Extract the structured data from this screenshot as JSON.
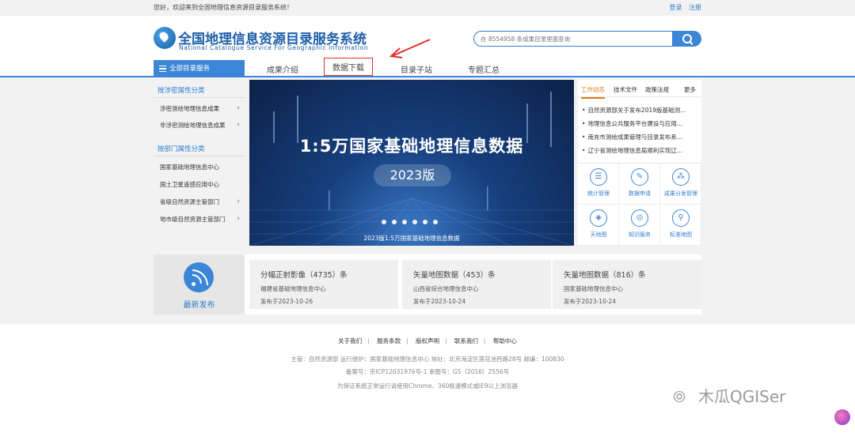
{
  "topbar": {
    "welcome": "您好，欢迎来到全国地理信息资源目录服务系统！",
    "login": "登录",
    "register": "注册"
  },
  "header": {
    "title": "全国地理信息资源目录服务系统",
    "subtitle": "National Catalogue Service For Geographic Information",
    "search_placeholder": "在 8554958 条成果目录里面查询"
  },
  "nav": {
    "all_label": "全部目录服务",
    "items": [
      "成果介绍",
      "数据下载",
      "目录子站",
      "专题汇总"
    ],
    "active": "数据下载"
  },
  "sidebar": {
    "group1": "按涉密属性分类",
    "group1_items": [
      "涉密测绘地理信息成果",
      "非涉密测绘地理信息成果"
    ],
    "group2": "按部门属性分类",
    "group2_items": [
      "国家基础地理信息中心",
      "国土卫星遥感应用中心",
      "省级自然资源主管部门",
      "地市级自然资源主管部门"
    ]
  },
  "banner": {
    "title": "1:5万国家基础地理信息数据",
    "version": "2023版",
    "caption": "2023版1:5万国家基础地理信息数据",
    "dot_count": 6
  },
  "right_panel": {
    "tabs": [
      "工作动态",
      "技术文件",
      "政策法规",
      "更多"
    ],
    "news": [
      "自然资源部关于发布2019版基础测...",
      "地理信息公共服务平台建设与应用...",
      "南充市测绘成果管理与目录发布系...",
      "辽宁省测绘地理信息局顺利实现辽..."
    ],
    "services": [
      {
        "label": "统计管理",
        "icon": "list-icon"
      },
      {
        "label": "数据申请",
        "icon": "edit-icon"
      },
      {
        "label": "成果分发管理",
        "icon": "share-icon"
      },
      {
        "label": "天地图",
        "icon": "map-icon"
      },
      {
        "label": "知识服务",
        "icon": "globe-icon"
      },
      {
        "label": "标准地图",
        "icon": "pin-icon"
      }
    ]
  },
  "latest": {
    "label": "最新发布",
    "cards": [
      {
        "title": "分幅正射影像（4735）条",
        "source": "福建省基础地理信息中心",
        "date": "发布于2023-10-26"
      },
      {
        "title": "矢量地图数据（453）条",
        "source": "山西省综合地理信息中心",
        "date": "发布于2023-10-24"
      },
      {
        "title": "矢量地图数据（816）条",
        "source": "国家基础地理信息中心",
        "date": "发布于2023-10-24"
      }
    ]
  },
  "footer": {
    "links": [
      "关于我们",
      "服务条款",
      "版权声明",
      "联系我们",
      "帮助中心"
    ],
    "line1": "主管：自然资源部  运行维护：国家基础地理信息中心  地址：北京海淀区莲花池西路28号  邮编：100830",
    "line2": "备案号：京ICP12031976号-1  审图号：GS（2016）2556号",
    "line3": "为保证系统正常运行请使用Chrome、360极速模式或IE9以上浏览器"
  },
  "watermark": "木瓜QGISer",
  "colors": {
    "brand_blue": "#3b86d6",
    "accent_orange": "#e07c1a",
    "highlight_red": "#e03030"
  }
}
